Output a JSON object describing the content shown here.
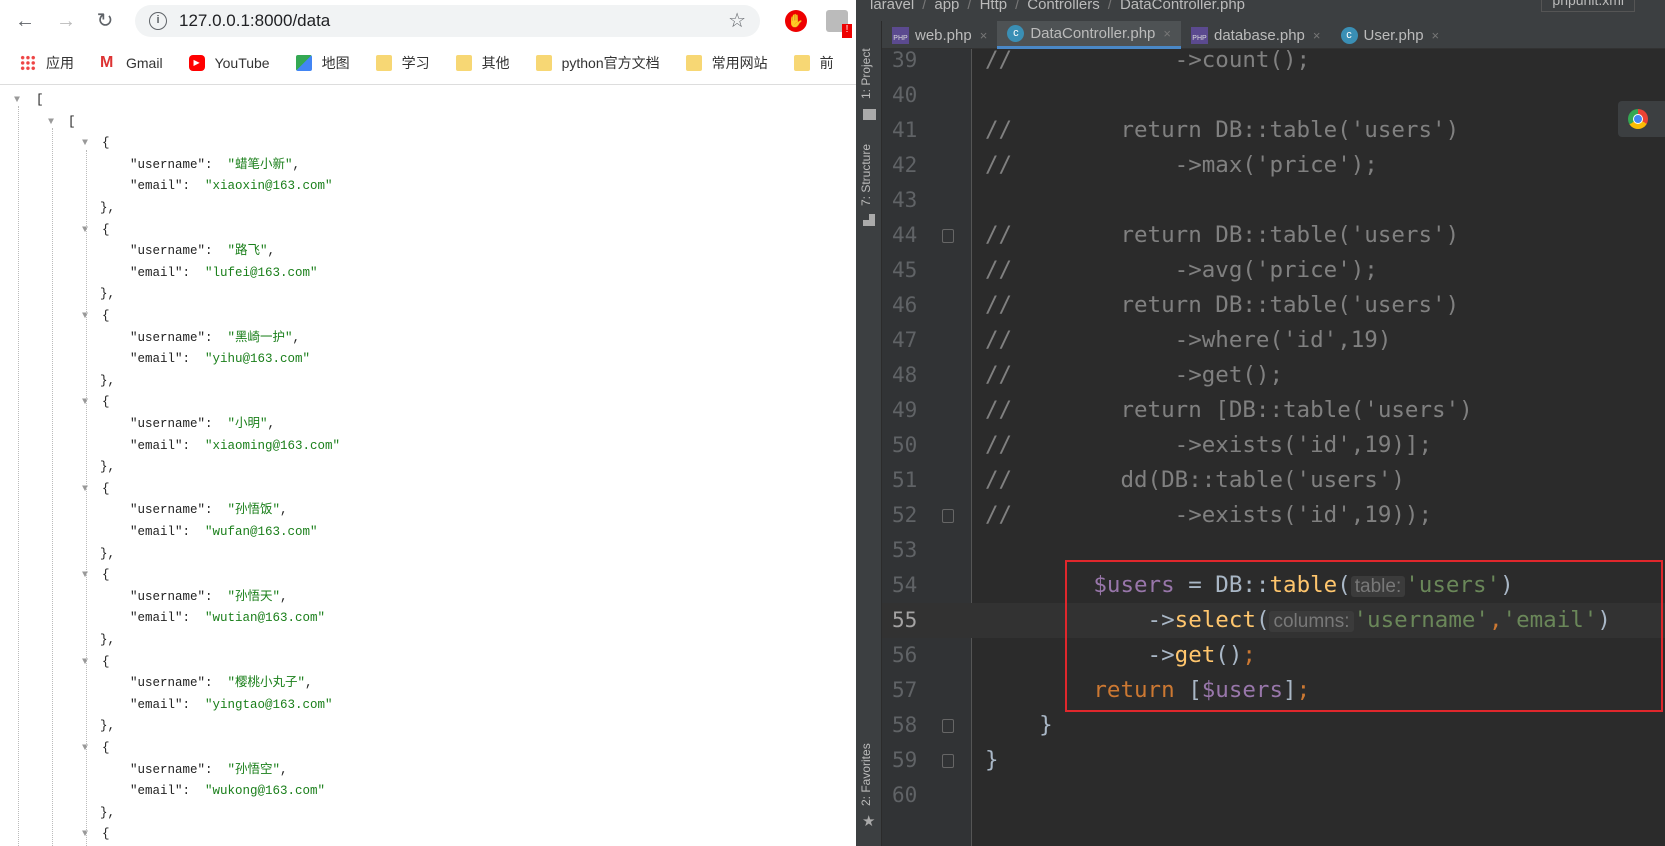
{
  "browser": {
    "url": "127.0.0.1:8000/data",
    "bookmarks": [
      {
        "label": "应用",
        "icon": "apps-icon"
      },
      {
        "label": "Gmail",
        "icon": "gmail-icon"
      },
      {
        "label": "YouTube",
        "icon": "youtube-icon"
      },
      {
        "label": "地图",
        "icon": "maps-icon"
      },
      {
        "label": "学习",
        "icon": "folder-icon"
      },
      {
        "label": "其他",
        "icon": "folder-icon"
      },
      {
        "label": "python官方文档",
        "icon": "folder-icon"
      },
      {
        "label": "常用网站",
        "icon": "folder-icon"
      },
      {
        "label": "前",
        "icon": "folder-icon"
      }
    ],
    "json_users": [
      {
        "username": "蜡笔小新",
        "email": "xiaoxin@163.com"
      },
      {
        "username": "路飞",
        "email": "lufei@163.com"
      },
      {
        "username": "黑崎一护",
        "email": "yihu@163.com"
      },
      {
        "username": "小明",
        "email": "xiaoming@163.com"
      },
      {
        "username": "孙悟饭",
        "email": "wufan@163.com"
      },
      {
        "username": "孙悟天",
        "email": "wutian@163.com"
      },
      {
        "username": "樱桃小丸子",
        "email": "yingtao@163.com"
      },
      {
        "username": "孙悟空",
        "email": "wukong@163.com"
      }
    ]
  },
  "ide": {
    "breadcrumb": [
      "laravel",
      "app",
      "Http",
      "Controllers",
      "DataController.php"
    ],
    "run_config": "phpunit.xml",
    "tool_windows": [
      "1: Project",
      "7: Structure",
      "2: Favorites"
    ],
    "tabs": [
      {
        "label": "web.php",
        "icon": "php-file-icon",
        "active": false
      },
      {
        "label": "DataController.php",
        "icon": "class-icon",
        "active": true
      },
      {
        "label": "database.php",
        "icon": "php-file-icon",
        "active": false
      },
      {
        "label": "User.php",
        "icon": "class-icon",
        "active": false
      }
    ],
    "current_line": 55,
    "lines": [
      {
        "n": "39",
        "parts": [
          [
            "cm",
            "//            ->count();"
          ]
        ]
      },
      {
        "n": "40",
        "parts": []
      },
      {
        "n": "41",
        "parts": [
          [
            "cm",
            "//        return DB::table('users')"
          ]
        ]
      },
      {
        "n": "42",
        "parts": [
          [
            "cm",
            "//            ->max('price');"
          ]
        ]
      },
      {
        "n": "43",
        "parts": []
      },
      {
        "n": "44",
        "parts": [
          [
            "cm",
            "//        return DB::table('users')"
          ]
        ],
        "fold": true
      },
      {
        "n": "45",
        "parts": [
          [
            "cm",
            "//            ->avg('price');"
          ]
        ]
      },
      {
        "n": "46",
        "parts": [
          [
            "cm",
            "//        return DB::table('users')"
          ]
        ]
      },
      {
        "n": "47",
        "parts": [
          [
            "cm",
            "//            ->where('id',19)"
          ]
        ]
      },
      {
        "n": "48",
        "parts": [
          [
            "cm",
            "//            ->get();"
          ]
        ]
      },
      {
        "n": "49",
        "parts": [
          [
            "cm",
            "//        return [DB::table('users')"
          ]
        ]
      },
      {
        "n": "50",
        "parts": [
          [
            "cm",
            "//            ->exists('id',19)];"
          ]
        ]
      },
      {
        "n": "51",
        "parts": [
          [
            "cm",
            "//        dd(DB::table('users')"
          ]
        ]
      },
      {
        "n": "52",
        "parts": [
          [
            "cm",
            "//            ->exists('id',19));"
          ]
        ],
        "fold": true
      },
      {
        "n": "53",
        "parts": []
      },
      {
        "n": "54",
        "parts": [
          [
            "",
            "        "
          ],
          [
            "var",
            "$users"
          ],
          [
            "",
            " = DB::"
          ],
          [
            "fn",
            "table"
          ],
          [
            "",
            "("
          ],
          [
            "hint",
            "table:"
          ],
          [
            "s",
            "'users'"
          ],
          [
            "",
            ")"
          ]
        ]
      },
      {
        "n": "55",
        "parts": [
          [
            "",
            "            ->"
          ],
          [
            "fn",
            "select"
          ],
          [
            "",
            "("
          ],
          [
            "hint",
            "columns:"
          ],
          [
            "s",
            "'username'"
          ],
          [
            "kw",
            ","
          ],
          [
            "s",
            "'email'"
          ],
          [
            "",
            ")"
          ]
        ]
      },
      {
        "n": "56",
        "parts": [
          [
            "",
            "            ->"
          ],
          [
            "fn",
            "get"
          ],
          [
            "",
            "()"
          ],
          [
            "kw",
            ";"
          ]
        ]
      },
      {
        "n": "57",
        "parts": [
          [
            "kw",
            "        return "
          ],
          [
            "",
            "["
          ],
          [
            "var",
            "$users"
          ],
          [
            "",
            "]"
          ],
          [
            "kw",
            ";"
          ]
        ]
      },
      {
        "n": "58",
        "parts": [
          [
            "",
            "    }"
          ]
        ],
        "fold": true
      },
      {
        "n": "59",
        "parts": [
          [
            "",
            "}"
          ]
        ],
        "fold": true
      },
      {
        "n": "60",
        "parts": []
      }
    ]
  },
  "colors": {
    "highlight_box": "#e0272c",
    "editor_bg": "#2b2b2b",
    "json_string": "#1a7f1a"
  }
}
